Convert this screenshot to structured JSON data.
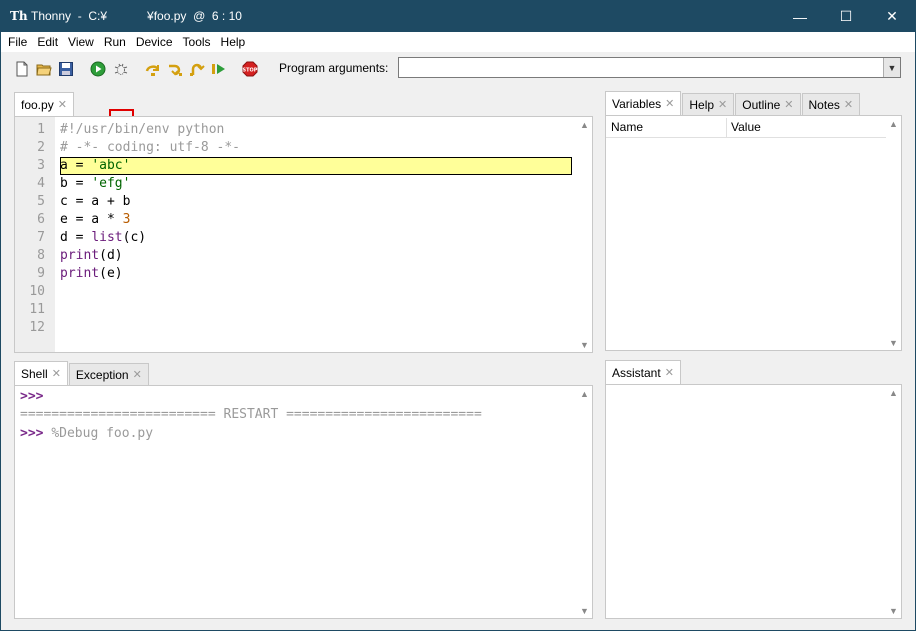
{
  "titlebar": {
    "title": "Thonny  -  C:¥            ¥foo.py  @  6 : 10",
    "minimize": "—",
    "maximize": "☐",
    "close": "✕"
  },
  "menu": [
    "File",
    "Edit",
    "View",
    "Run",
    "Device",
    "Tools",
    "Help"
  ],
  "toolbar": {
    "program_arguments_label": "Program arguments:",
    "program_arguments_value": ""
  },
  "editor": {
    "tab_label": "foo.py",
    "current_line": 3,
    "line_numbers": [
      "1",
      "2",
      "3",
      "4",
      "5",
      "6",
      "7",
      "8",
      "9",
      "10",
      "11",
      "12"
    ],
    "lines": [
      "#!/usr/bin/env python",
      "# -*- coding: utf-8 -*-",
      "a = 'abc'",
      "b = 'efg'",
      "c = a + b",
      "e = a * 3",
      "d = list(c)",
      "print(d)",
      "print(e)"
    ]
  },
  "bottom_tabs": [
    "Shell",
    "Exception"
  ],
  "shell": {
    "prompt": ">>>",
    "restart": "========================= RESTART =========================",
    "command": "%Debug foo.py"
  },
  "right_tabs": [
    "Variables",
    "Help",
    "Outline",
    "Notes"
  ],
  "variables": {
    "col_name": "Name",
    "col_value": "Value"
  },
  "assistant_tab": "Assistant",
  "colors": {
    "titlebar": "#1e4a63",
    "current_line": "#ffff99",
    "debug_highlight": "#e00000"
  }
}
